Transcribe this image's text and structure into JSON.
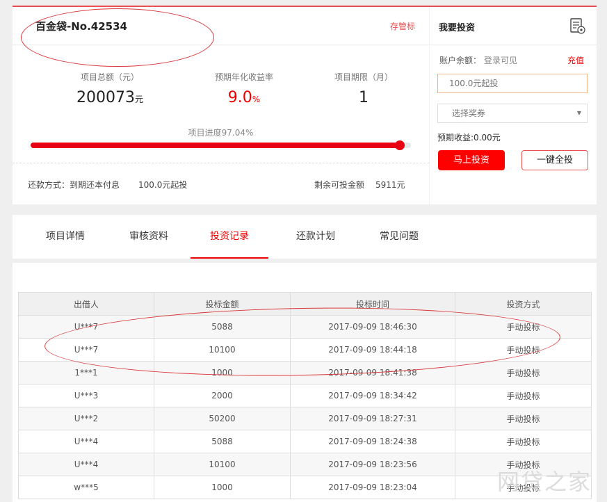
{
  "product": {
    "title": "百金袋-No.42534",
    "tag": "存管标",
    "stats": [
      {
        "label": "项目总额（元）",
        "value": "200073",
        "unit": "元"
      },
      {
        "label": "预期年化收益率",
        "value": "9.0",
        "unit": "%"
      },
      {
        "label": "项目期限（月）",
        "value": "1",
        "unit": ""
      }
    ],
    "progress_label": "项目进度97.04%",
    "progress_fraction": 0.9704,
    "repay_method": "还款方式：到期还本付息",
    "min_invest": "100.0元起投",
    "remaining_label": "剩余可投金额",
    "remaining_value": "5911元"
  },
  "invest": {
    "title": "我要投资",
    "balance_label": "账户余额：",
    "balance_value": "登录可见",
    "recharge": "充值",
    "amount_placeholder": "100.0元起投",
    "coupon_placeholder": "选择奖券",
    "expected_income": "预期收益:0.00元",
    "invest_button": "马上投资",
    "invest_all_button": "一键全投"
  },
  "tabs": [
    {
      "label": "项目详情",
      "active": false
    },
    {
      "label": "审核资料",
      "active": false
    },
    {
      "label": "投资记录",
      "active": true
    },
    {
      "label": "还款计划",
      "active": false
    },
    {
      "label": "常见问题",
      "active": false
    }
  ],
  "records": {
    "columns": [
      "出借人",
      "投标金额",
      "投标时间",
      "投资方式"
    ],
    "rows": [
      [
        "U***7",
        "5088",
        "2017-09-09 18:46:30",
        "手动投标"
      ],
      [
        "U***7",
        "10100",
        "2017-09-09 18:44:18",
        "手动投标"
      ],
      [
        "1***1",
        "1000",
        "2017-09-09 18:41:38",
        "手动投标"
      ],
      [
        "U***3",
        "2000",
        "2017-09-09 18:34:42",
        "手动投标"
      ],
      [
        "U***2",
        "50200",
        "2017-09-09 18:27:31",
        "手动投标"
      ],
      [
        "U***4",
        "5088",
        "2017-09-09 18:24:38",
        "手动投标"
      ],
      [
        "U***4",
        "10100",
        "2017-09-09 18:23:56",
        "手动投标"
      ],
      [
        "w***5",
        "1000",
        "2017-09-09 18:23:04",
        "手动投标"
      ]
    ]
  },
  "watermark": "网贷之家",
  "accent_color": "#e60012"
}
